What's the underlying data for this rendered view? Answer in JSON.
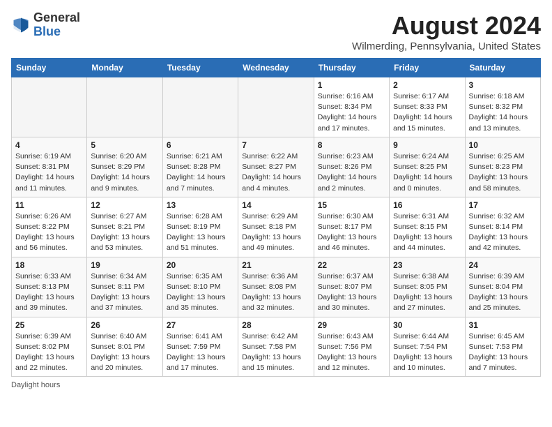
{
  "logo": {
    "general": "General",
    "blue": "Blue"
  },
  "header": {
    "month_year": "August 2024",
    "location": "Wilmerding, Pennsylvania, United States"
  },
  "days_of_week": [
    "Sunday",
    "Monday",
    "Tuesday",
    "Wednesday",
    "Thursday",
    "Friday",
    "Saturday"
  ],
  "weeks": [
    [
      {
        "day": "",
        "empty": true
      },
      {
        "day": "",
        "empty": true
      },
      {
        "day": "",
        "empty": true
      },
      {
        "day": "",
        "empty": true
      },
      {
        "day": "1",
        "sunrise": "6:16 AM",
        "sunset": "8:34 PM",
        "daylight": "14 hours and 17 minutes."
      },
      {
        "day": "2",
        "sunrise": "6:17 AM",
        "sunset": "8:33 PM",
        "daylight": "14 hours and 15 minutes."
      },
      {
        "day": "3",
        "sunrise": "6:18 AM",
        "sunset": "8:32 PM",
        "daylight": "14 hours and 13 minutes."
      }
    ],
    [
      {
        "day": "4",
        "sunrise": "6:19 AM",
        "sunset": "8:31 PM",
        "daylight": "14 hours and 11 minutes."
      },
      {
        "day": "5",
        "sunrise": "6:20 AM",
        "sunset": "8:29 PM",
        "daylight": "14 hours and 9 minutes."
      },
      {
        "day": "6",
        "sunrise": "6:21 AM",
        "sunset": "8:28 PM",
        "daylight": "14 hours and 7 minutes."
      },
      {
        "day": "7",
        "sunrise": "6:22 AM",
        "sunset": "8:27 PM",
        "daylight": "14 hours and 4 minutes."
      },
      {
        "day": "8",
        "sunrise": "6:23 AM",
        "sunset": "8:26 PM",
        "daylight": "14 hours and 2 minutes."
      },
      {
        "day": "9",
        "sunrise": "6:24 AM",
        "sunset": "8:25 PM",
        "daylight": "14 hours and 0 minutes."
      },
      {
        "day": "10",
        "sunrise": "6:25 AM",
        "sunset": "8:23 PM",
        "daylight": "13 hours and 58 minutes."
      }
    ],
    [
      {
        "day": "11",
        "sunrise": "6:26 AM",
        "sunset": "8:22 PM",
        "daylight": "13 hours and 56 minutes."
      },
      {
        "day": "12",
        "sunrise": "6:27 AM",
        "sunset": "8:21 PM",
        "daylight": "13 hours and 53 minutes."
      },
      {
        "day": "13",
        "sunrise": "6:28 AM",
        "sunset": "8:19 PM",
        "daylight": "13 hours and 51 minutes."
      },
      {
        "day": "14",
        "sunrise": "6:29 AM",
        "sunset": "8:18 PM",
        "daylight": "13 hours and 49 minutes."
      },
      {
        "day": "15",
        "sunrise": "6:30 AM",
        "sunset": "8:17 PM",
        "daylight": "13 hours and 46 minutes."
      },
      {
        "day": "16",
        "sunrise": "6:31 AM",
        "sunset": "8:15 PM",
        "daylight": "13 hours and 44 minutes."
      },
      {
        "day": "17",
        "sunrise": "6:32 AM",
        "sunset": "8:14 PM",
        "daylight": "13 hours and 42 minutes."
      }
    ],
    [
      {
        "day": "18",
        "sunrise": "6:33 AM",
        "sunset": "8:13 PM",
        "daylight": "13 hours and 39 minutes."
      },
      {
        "day": "19",
        "sunrise": "6:34 AM",
        "sunset": "8:11 PM",
        "daylight": "13 hours and 37 minutes."
      },
      {
        "day": "20",
        "sunrise": "6:35 AM",
        "sunset": "8:10 PM",
        "daylight": "13 hours and 35 minutes."
      },
      {
        "day": "21",
        "sunrise": "6:36 AM",
        "sunset": "8:08 PM",
        "daylight": "13 hours and 32 minutes."
      },
      {
        "day": "22",
        "sunrise": "6:37 AM",
        "sunset": "8:07 PM",
        "daylight": "13 hours and 30 minutes."
      },
      {
        "day": "23",
        "sunrise": "6:38 AM",
        "sunset": "8:05 PM",
        "daylight": "13 hours and 27 minutes."
      },
      {
        "day": "24",
        "sunrise": "6:39 AM",
        "sunset": "8:04 PM",
        "daylight": "13 hours and 25 minutes."
      }
    ],
    [
      {
        "day": "25",
        "sunrise": "6:39 AM",
        "sunset": "8:02 PM",
        "daylight": "13 hours and 22 minutes."
      },
      {
        "day": "26",
        "sunrise": "6:40 AM",
        "sunset": "8:01 PM",
        "daylight": "13 hours and 20 minutes."
      },
      {
        "day": "27",
        "sunrise": "6:41 AM",
        "sunset": "7:59 PM",
        "daylight": "13 hours and 17 minutes."
      },
      {
        "day": "28",
        "sunrise": "6:42 AM",
        "sunset": "7:58 PM",
        "daylight": "13 hours and 15 minutes."
      },
      {
        "day": "29",
        "sunrise": "6:43 AM",
        "sunset": "7:56 PM",
        "daylight": "13 hours and 12 minutes."
      },
      {
        "day": "30",
        "sunrise": "6:44 AM",
        "sunset": "7:54 PM",
        "daylight": "13 hours and 10 minutes."
      },
      {
        "day": "31",
        "sunrise": "6:45 AM",
        "sunset": "7:53 PM",
        "daylight": "13 hours and 7 minutes."
      }
    ]
  ],
  "footer": {
    "note": "Daylight hours"
  }
}
